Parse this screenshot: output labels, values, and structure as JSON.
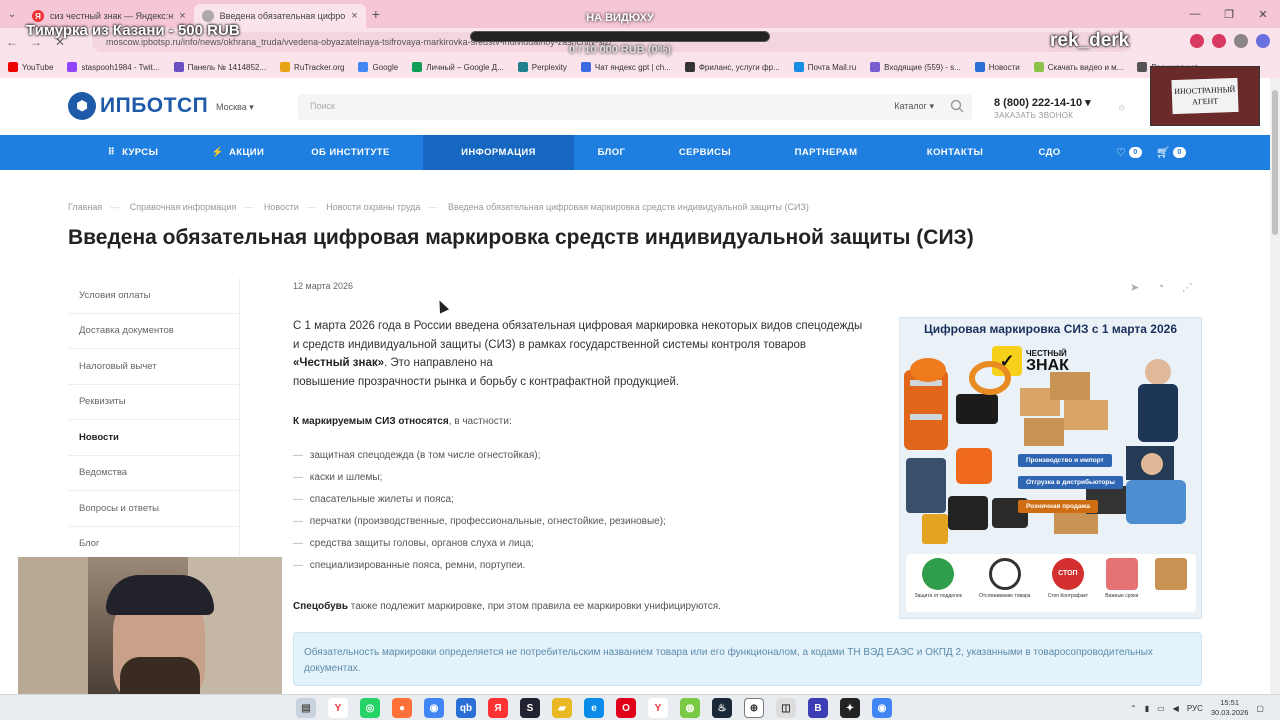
{
  "browser": {
    "tabs": [
      {
        "title": "сиз честный знак — Яндекс:н"
      },
      {
        "title": "Введена обязательная цифро"
      }
    ],
    "url": "moscow.ipbotsp.ru/info/news/okhrana_truda/vvedena-obyazatelnaya-tsifrovaya-markirovka-sredstv-individualnoy-zashchity-siz/",
    "bookmarks": [
      "YouTube",
      "staspooh1984 - Twit...",
      "Панель № 1414852...",
      "RuTracker.org",
      "Google",
      "Личный – Google Д...",
      "Perplexity",
      "Чат яндекс gpt | ch...",
      "Фриланс, услуги фр...",
      "Почта Mail.ru",
      "Входящие (559) - s...",
      "Новости",
      "Скачать видео и м...",
      "Расширения"
    ]
  },
  "overlay": {
    "donation": "Тимурка из Казани - 500 RUB",
    "goal_title": "НА ВИДЮХУ",
    "goal_progress": "0 / 10 000 RUB (0%)",
    "goal_fraction": 0,
    "streamer": "rek_derk",
    "agent_sign": "ИНОСТРАННЫЙ АГЕНТ"
  },
  "header": {
    "logo": "ИПБОТСП",
    "city": "Москва ▾",
    "search_placeholder": "Поиск",
    "catalog": "Каталог ▾",
    "phone": "8 (800) 222-14-10 ▾",
    "callback": "ЗАКАЗАТЬ ЗВОНОК"
  },
  "menu": {
    "items": [
      "КУРСЫ",
      "АКЦИИ",
      "ОБ ИНСТИТУТЕ",
      "ИНФОРМАЦИЯ",
      "БЛОГ",
      "СЕРВИСЫ",
      "ПАРТНЕРАМ",
      "КОНТАКТЫ",
      "СДО"
    ],
    "favorites_count": "0",
    "cart_count": "0"
  },
  "breadcrumb": [
    "Главная",
    "Справочная информация",
    "Новости",
    "Новости охраны труда",
    "Введена обязательная цифровая маркировка средств индивидуальной защиты (СИЗ)"
  ],
  "page_title": "Введена обязательная цифровая маркировка средств индивидуальной защиты (СИЗ)",
  "sidebar": [
    "Условия оплаты",
    "Доставка документов",
    "Налоговый вычет",
    "Реквизиты",
    "Новости",
    "Ведомства",
    "Вопросы и ответы",
    "Блог"
  ],
  "article": {
    "date": "12 марта 2026",
    "lead_1": "С 1 марта 2026 года в России введена обязательная цифровая маркировка некоторых видов спецодежды и средств индивидуальной защиты (СИЗ) в рамках государственной системы контроля товаров ",
    "lead_bold": "«Честный знак»",
    "lead_2": ". Это направлено на",
    "lead_3": "повышение прозрачности рынка и борьбу с контрафактной продукцией.",
    "subhead_bold": "К маркируемым СИЗ относятся",
    "subhead_rest": ", в частности:",
    "list": [
      "защитная спецодежда (в том числе огнестойкая);",
      "каски и шлемы;",
      "спасательные жилеты и пояса;",
      "перчатки (производственные, профессиональные, огнестойкие, резиновые);",
      "средства защиты головы, органов слуха и лица;",
      "специализированные пояса, ремни, портупеи."
    ],
    "spec_bold": "Спецобувь",
    "spec_rest": " также подлежит маркировке, при этом правила ее маркировки унифицируются.",
    "note": "Обязательность маркировки определяется не потребительским названием товара или его функционалом, а кодами ТН ВЭД ЕАЭС и ОКПД 2, указанными в товаросопроводительных документах."
  },
  "image": {
    "title": "Цифровая маркировка СИЗ с 1 марта 2026",
    "logo_top": "ЧЕСТНЫЙ",
    "logo_bottom": "ЗНАК",
    "labels": [
      "Производство и импорт",
      "Отгрузка в дистрибьюторы",
      "Розничная продажа"
    ],
    "bottom": [
      "Защита от подделок",
      "Отслеживание товара",
      "Стоп Контрафакт",
      "Важные сроки"
    ],
    "stop_text": "СТОП"
  },
  "taskbar": {
    "lang": "РУС",
    "time": "15:51",
    "date": "30.03.2026"
  },
  "colors": {
    "menu_blue": "#1e7fe0",
    "menu_active": "#1667c2",
    "logo_blue": "#1e5aa8"
  }
}
